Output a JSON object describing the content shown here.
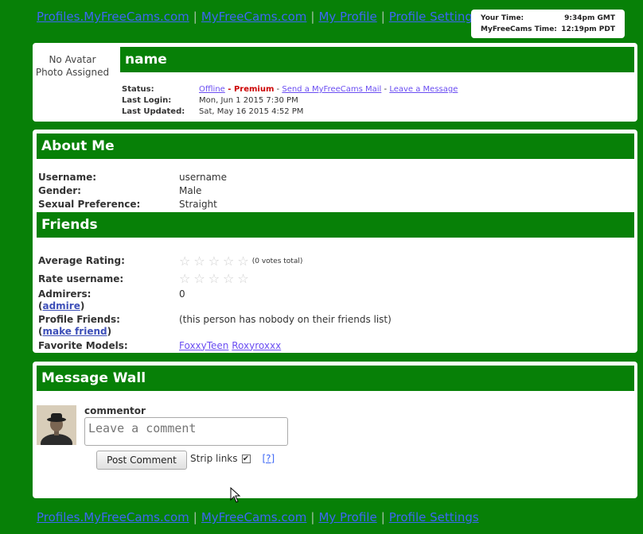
{
  "nav": {
    "links": [
      "Profiles.MyFreeCams.com",
      "MyFreeCams.com",
      "My Profile",
      "Profile Settings"
    ],
    "separator": "|"
  },
  "time": {
    "your_label": "Your Time:",
    "your_value": "9:34pm GMT",
    "mfc_label": "MyFreeCams Time:",
    "mfc_value": "12:19pm PDT"
  },
  "profile": {
    "no_avatar_line1": "No Avatar",
    "no_avatar_line2": "Photo Assigned",
    "name": "name",
    "status_label": "Status:",
    "status_value": "Offline",
    "dash1": " - ",
    "premium": "Premium",
    "dash2": " - ",
    "send_mail": "Send a MyFreeCams Mail",
    "dash3": " - ",
    "leave_message": "Leave a Message",
    "last_login_label": "Last Login:",
    "last_login_value": "Mon, Jun 1 2015 7:30 PM",
    "last_updated_label": "Last Updated:",
    "last_updated_value": "Sat, May 16 2015 4:52 PM"
  },
  "about": {
    "title": "About Me",
    "username_label": "Username:",
    "username_value": "username",
    "gender_label": "Gender:",
    "gender_value": "Male",
    "pref_label": "Sexual Preference:",
    "pref_value": "Straight"
  },
  "friends": {
    "title": "Friends",
    "avg_rating_label": "Average Rating:",
    "avg_rating_stars": 0,
    "votes": "(0 votes total)",
    "rate_label": "Rate username:",
    "admirers_label": "Admirers:",
    "admire_link": "admire",
    "admirers_value": "0",
    "profile_friends_label": "Profile Friends:",
    "make_friend_link": "make friend",
    "profile_friends_value": "(this person has nobody on their friends list)",
    "favorite_models_label": "Favorite Models:",
    "favorite_models": [
      "FoxxyTeen",
      "Roxyroxxx"
    ]
  },
  "wall": {
    "title": "Message Wall",
    "commentor": "commentor",
    "placeholder": "Leave a comment",
    "post_button": "Post Comment",
    "strip_links": "Strip links",
    "help_link": "[?]"
  },
  "colors": {
    "background": "#078007",
    "link": "#3d67f5",
    "premium": "#cc0000"
  }
}
